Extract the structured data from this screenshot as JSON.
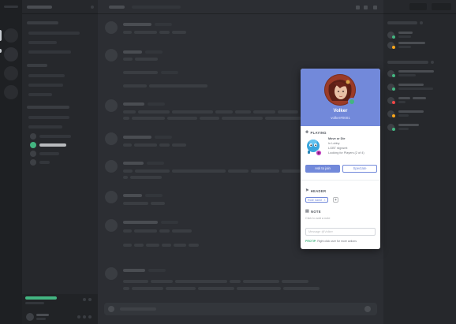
{
  "profile": {
    "name": "Volker",
    "tag": "volker#0001",
    "status_color": "#43b581",
    "header_color": "#7289da"
  },
  "playing": {
    "section_title": "PLAYING",
    "game_name": "Move or Die",
    "line1": "In Lobby",
    "line2": "LGBT rdgvsmt",
    "line3": "Looking for Players (2 of 4)",
    "join_label": "Ask to join",
    "spectate_label": "Spectate"
  },
  "header_section": {
    "title": "HEADER",
    "role_label": "Role name",
    "role_remove": "×",
    "role_add": "+"
  },
  "note": {
    "title": "NOTE",
    "placeholder": "Click to add a note"
  },
  "message": {
    "placeholder": "Message @Volker"
  },
  "protip": {
    "label": "PROTIP:",
    "text": "Right click user for more actions"
  },
  "colors": {
    "accent": "#7289da",
    "online": "#43b581",
    "idle": "#faa61a",
    "dnd": "#f04747"
  }
}
